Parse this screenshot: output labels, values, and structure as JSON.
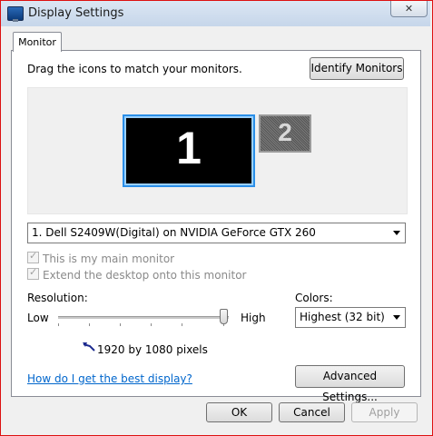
{
  "window": {
    "title": "Display Settings",
    "close_symbol": "✕"
  },
  "tab": {
    "label": "Monitor"
  },
  "instruction": "Drag the icons to match your monitors.",
  "identify_button": "Identify Monitors",
  "monitors": [
    {
      "number": "1",
      "selected": true
    },
    {
      "number": "2",
      "selected": false
    }
  ],
  "display_select": {
    "value": "1. Dell S2409W(Digital) on NVIDIA GeForce GTX 260"
  },
  "checkboxes": {
    "main_monitor": {
      "label": "This is my main monitor",
      "checked": true,
      "enabled": false
    },
    "extend_desktop": {
      "label": "Extend the desktop onto this monitor",
      "checked": true,
      "enabled": false
    }
  },
  "resolution": {
    "label": "Resolution:",
    "low_label": "Low",
    "high_label": "High",
    "level": 1.0,
    "value_text": "1920 by 1080 pixels"
  },
  "colors": {
    "label": "Colors:",
    "value": "Highest (32 bit)"
  },
  "help_link": "How do I get the best display?",
  "advanced_button": "Advanced Settings...",
  "footer": {
    "ok": "OK",
    "cancel": "Cancel",
    "apply": "Apply"
  },
  "accent": {
    "selected_border": "#2b8fe8",
    "link": "#0066cc",
    "window_border": "#dd1111"
  }
}
